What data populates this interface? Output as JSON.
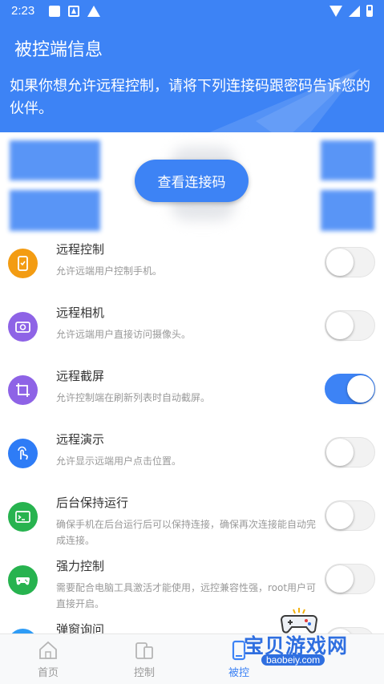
{
  "status_bar": {
    "time": "2:23",
    "icons": [
      "square-notification-icon",
      "a-box-notification-icon",
      "warning-icon",
      "wifi-icon",
      "signal-icon",
      "battery-icon"
    ]
  },
  "header": {
    "title": "被控端信息",
    "description": "如果你想允许远程控制，请将下列连接码跟密码告诉您的伙伴。"
  },
  "connection": {
    "view_code_button": "查看连接码"
  },
  "settings": [
    {
      "title": "远程控制",
      "desc": "允许远端用户控制手机。",
      "icon": "phone-control-icon",
      "icon_color": "#f39c12",
      "enabled": false
    },
    {
      "title": "远程相机",
      "desc": "允许远端用户直接访问摄像头。",
      "icon": "camera-icon",
      "icon_color": "#8e63e6",
      "enabled": false
    },
    {
      "title": "远程截屏",
      "desc": "允许控制端在刷新列表时自动截屏。",
      "icon": "screenshot-crop-icon",
      "icon_color": "#8e63e6",
      "enabled": true
    },
    {
      "title": "远程演示",
      "desc": "允许显示远端用户点击位置。",
      "icon": "touch-gesture-icon",
      "icon_color": "#2e7cf6",
      "enabled": false
    },
    {
      "title": "后台保持运行",
      "desc": "确保手机在后台运行后可以保持连接，确保再次连接能自动完成连接。",
      "icon": "terminal-window-icon",
      "icon_color": "#27b34f",
      "enabled": false
    },
    {
      "title": "强力控制",
      "desc": "需要配合电脑工具激活才能使用，远控兼容性强，root用户可直接开启。",
      "icon": "gamepad-icon",
      "icon_color": "#27b34f",
      "enabled": false
    },
    {
      "title": "弹窗询问",
      "desc": "",
      "icon": "popup-icon",
      "icon_color": "#2e9cf6",
      "enabled": false
    }
  ],
  "bottom_nav": {
    "items": [
      {
        "label": "首页",
        "icon": "home-icon",
        "active": false
      },
      {
        "label": "控制",
        "icon": "devices-icon",
        "active": false
      },
      {
        "label": "被控",
        "icon": "phone-icon",
        "active": true
      }
    ]
  },
  "watermark": {
    "text": "宝贝游戏网",
    "url": "baobeiy.com"
  },
  "colors": {
    "primary": "#3d83f5",
    "toggle_off": "#f2f2f2",
    "text_secondary": "#999999"
  }
}
